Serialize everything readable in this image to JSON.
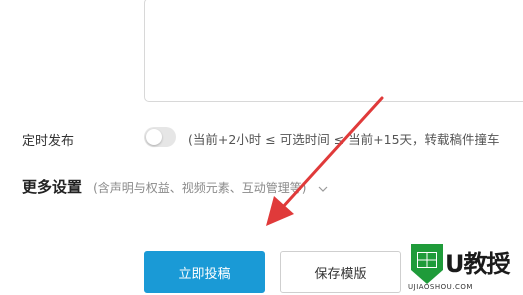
{
  "schedule": {
    "label": "定时发布",
    "toggle_on": false,
    "hint": "(当前+2小时 ≤ 可选时间 ≤ 当前+15天，转载稿件撞车"
  },
  "more_settings": {
    "title": "更多设置",
    "subtitle": "(含声明与权益、视频元素、互动管理等)"
  },
  "actions": {
    "submit_label": "立即投稿",
    "save_template_label": "保存模版"
  },
  "watermark": {
    "brand": "U教授",
    "url": "UJIAOSHOU.COM"
  },
  "colors": {
    "primary": "#1a9ad6",
    "arrow": "#e03a3a",
    "logo_green": "#1f9b3a"
  }
}
